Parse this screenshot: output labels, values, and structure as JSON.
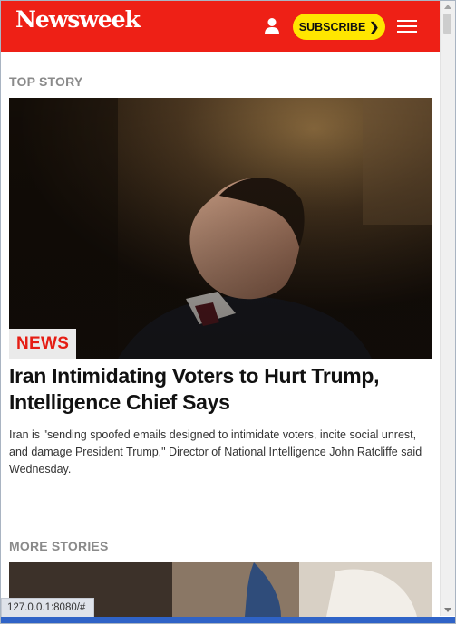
{
  "header": {
    "logo": "Newsweek",
    "subscribe_label": "SUBSCRIBE",
    "subscribe_chevron": "❯",
    "colors": {
      "brand_red": "#ee2016",
      "subscribe_yellow": "#ffe600"
    },
    "icons": [
      "user-icon",
      "menu-icon"
    ]
  },
  "top_story": {
    "section_label": "TOP STORY",
    "badge": "NEWS",
    "headline": "Iran Intimidating Voters to Hurt Trump, Intelligence Chief Says",
    "summary": "Iran is \"sending spoofed emails designed to intimidate voters, incite social unrest, and damage President Trump,\" Director of National Intelligence John Ratcliffe said Wednesday.",
    "badge_color": "#e51d14"
  },
  "more_stories": {
    "section_label": "MORE STORIES"
  },
  "status_bar": {
    "url": "127.0.0.1:8080/#"
  }
}
